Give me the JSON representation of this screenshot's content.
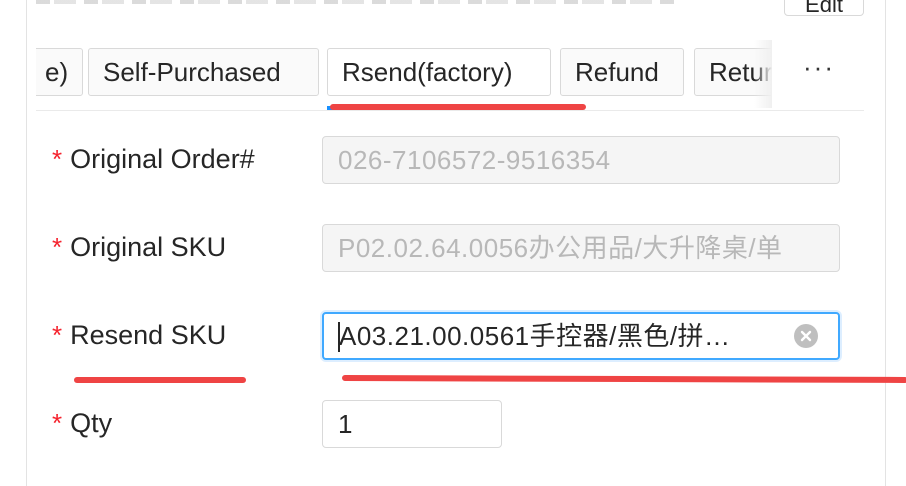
{
  "header": {
    "edit_label": "Edit"
  },
  "tabs": [
    {
      "label": "e)",
      "active": false
    },
    {
      "label": "Self-Purchased",
      "active": false
    },
    {
      "label": "Rsend(factory)",
      "active": true
    },
    {
      "label": "Refund",
      "active": false
    },
    {
      "label": "Retur",
      "active": false
    }
  ],
  "more_label": "···",
  "form": {
    "original_order": {
      "label": "Original Order#",
      "value": "026-7106572-9516354",
      "disabled": true
    },
    "original_sku": {
      "label": "Original SKU",
      "value": "P02.02.64.0056办公用品/大升降桌/单",
      "disabled": true
    },
    "resend_sku": {
      "label": "Resend SKU",
      "value": "A03.21.00.0561手控器/黑色/拼…",
      "focused": true
    },
    "qty": {
      "label": "Qty",
      "value": "1"
    }
  },
  "required_mark": "*",
  "colors": {
    "required": "#f5222d",
    "focus_border": "#40a9ff",
    "annotation": "#ef4444"
  }
}
